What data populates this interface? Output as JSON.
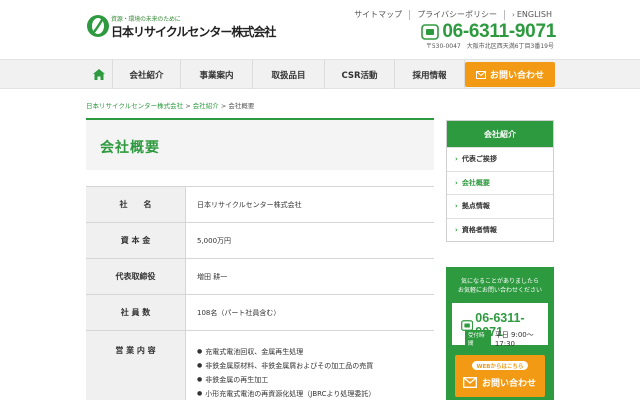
{
  "header": {
    "logo_tagline": "資源・環境の未来のために",
    "logo_name": "日本リサイクルセンター株式会社",
    "links": [
      "サイトマップ",
      "プライバシーポリシー"
    ],
    "english_label": "ENGLISH",
    "phone": "06-6311-9071",
    "address": "〒530-0047　大阪市北区西天満6丁目3番19号"
  },
  "nav": {
    "home_icon": "home-icon",
    "items": [
      "会社紹介",
      "事業案内",
      "取扱品目",
      "CSR活動",
      "採用情報"
    ],
    "contact_label": "お問い合わせ"
  },
  "breadcrumb": {
    "home": "日本リサイクルセンター株式会社",
    "parent": "会社紹介",
    "current": "会社概要",
    "separator": ">"
  },
  "page": {
    "title": "会社概要"
  },
  "table": {
    "rows": [
      {
        "label": "社　　名",
        "value": "日本リサイクルセンター株式会社"
      },
      {
        "label": "資 本 金",
        "value": "5,000万円"
      },
      {
        "label": "代表取締役",
        "value": "増田 耕一"
      },
      {
        "label": "社 員 数",
        "value": "108名（パート社員含む）"
      }
    ],
    "business": {
      "label": "営 業 内 容",
      "items": [
        "充電式電池回収、金属再生処理",
        "非鉄金属原材料、非鉄金属屑およびその加工品の売買",
        "非鉄金属の再生加工",
        "小形充電式電池の再資源化処理（JBRCより処理委託）"
      ]
    }
  },
  "sidebar": {
    "heading": "会社紹介",
    "items": [
      "代表ご挨拶",
      "会社概要",
      "拠点情報",
      "資格者情報"
    ],
    "active_index": 1
  },
  "contact_box": {
    "text_line1": "気になることがありましたら",
    "text_line2": "お気軽にお問い合わせください",
    "phone": "06-6311-9071",
    "hours_badge": "受付時間",
    "hours": "平日 9:00〜17:30",
    "web_label": "WEBからはこちら",
    "mail_label": "お問い合わせ"
  },
  "colors": {
    "brand_green": "#2e9a3f",
    "accent_orange": "#f29a14"
  }
}
